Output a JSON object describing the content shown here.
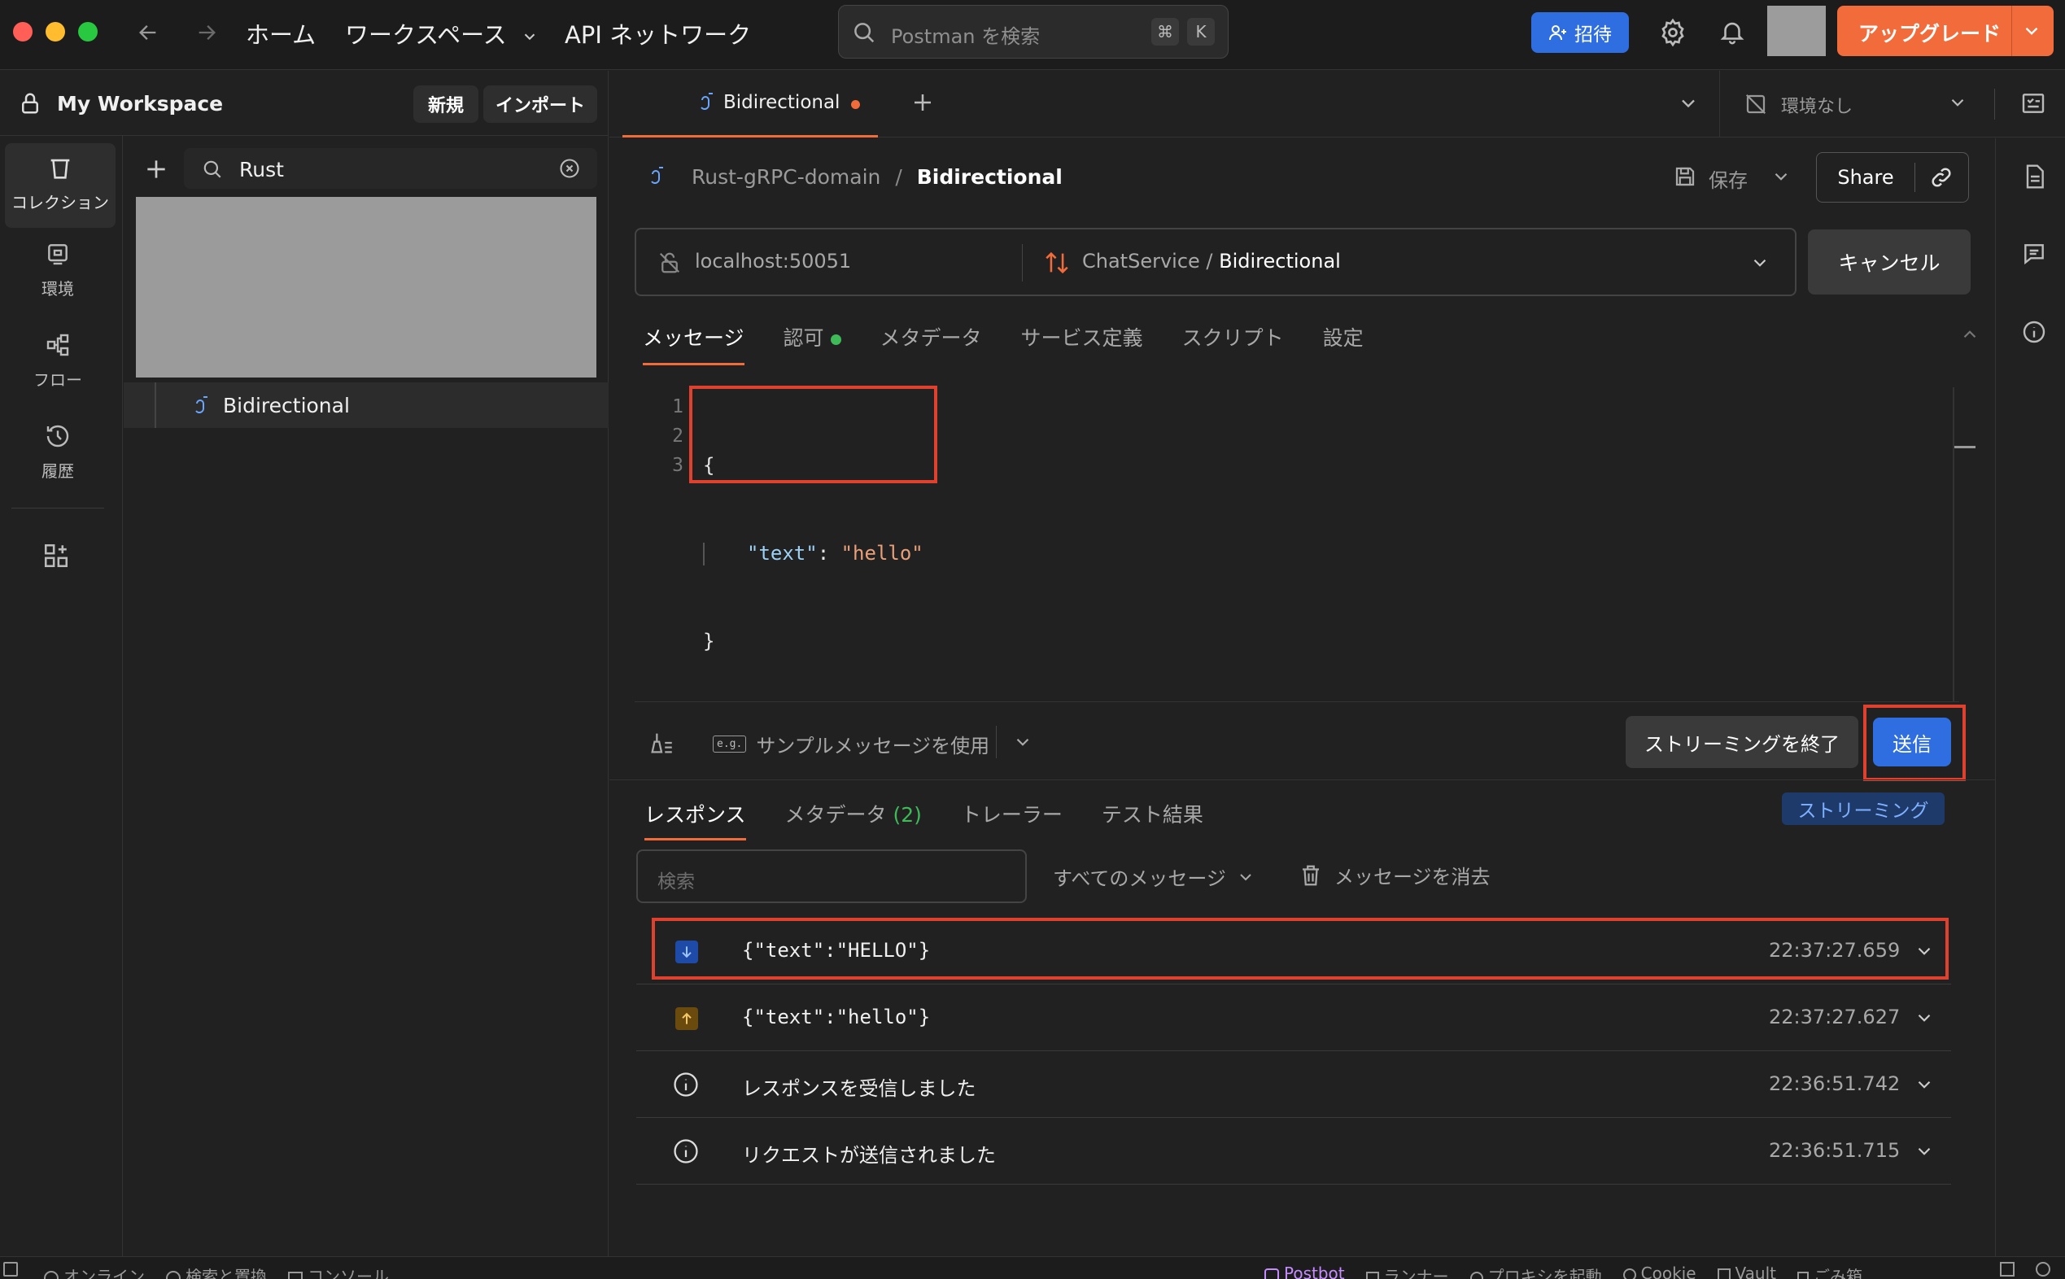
{
  "nav": {
    "home": "ホーム",
    "workspaces": "ワークスペース",
    "api_network": "API ネットワーク",
    "search_placeholder": "Postman を検索",
    "kbd_cmd": "⌘",
    "kbd_k": "K",
    "invite": "招待",
    "upgrade": "アップグレード"
  },
  "sidebar": {
    "workspace_title": "My Workspace",
    "new_btn": "新規",
    "import_btn": "インポート",
    "search_value": "Rust",
    "rail": [
      {
        "label": "コレクション",
        "icon": "collection-icon"
      },
      {
        "label": "環境",
        "icon": "environment-icon"
      },
      {
        "label": "フロー",
        "icon": "flows-icon"
      },
      {
        "label": "履歴",
        "icon": "history-icon"
      }
    ],
    "tree_item": "Bidirectional"
  },
  "tabs": {
    "open_tab": "Bidirectional",
    "env": "環境なし"
  },
  "request": {
    "breadcrumb_parent": "Rust-gRPC-domain",
    "breadcrumb_sep": "/",
    "breadcrumb_current": "Bidirectional",
    "save": "保存",
    "share": "Share",
    "url": "localhost:50051",
    "method_service": "ChatService /",
    "method_name": "Bidirectional",
    "cancel": "キャンセル",
    "subtabs": [
      "メッセージ",
      "認可",
      "メタデータ",
      "サービス定義",
      "スクリプト",
      "設定"
    ],
    "code_lines": [
      "1",
      "2",
      "3"
    ],
    "code_open": "{",
    "code_key": "\"text\"",
    "code_colon": ":",
    "code_value": "\"hello\"",
    "code_close": "}",
    "sample_msg": "サンプルメッセージを使用",
    "sample_tag": "e.g.",
    "end_stream": "ストリーミングを終了",
    "send": "送信"
  },
  "response": {
    "tabs": [
      "レスポンス",
      "メタデータ",
      "トレーラー",
      "テスト結果"
    ],
    "metadata_count": "(2)",
    "streaming_badge": "ストリーミング",
    "search_placeholder": "検索",
    "filter": "すべてのメッセージ",
    "clear": "メッセージを消去",
    "messages": [
      {
        "dir": "received",
        "text": "{\"text\":\"HELLO\"}",
        "time": "22:37:27.659"
      },
      {
        "dir": "sent",
        "text": "{\"text\":\"hello\"}",
        "time": "22:37:27.627"
      },
      {
        "dir": "info",
        "text": "レスポンスを受信しました",
        "time": "22:36:51.742"
      },
      {
        "dir": "info",
        "text": "リクエストが送信されました",
        "time": "22:36:51.715"
      }
    ]
  },
  "statusbar": {
    "left": [
      "オンライン",
      "検索と置換",
      "コンソール"
    ],
    "right": [
      "Postbot",
      "ランナー",
      "プロキシを起動",
      "Cookie",
      "Vault",
      "ごみ箱"
    ]
  },
  "colors": {
    "accent_orange": "#f26b3a",
    "accent_blue": "#2f6ee0",
    "highlight_red": "#e0412f",
    "status_green": "#3fba58"
  }
}
